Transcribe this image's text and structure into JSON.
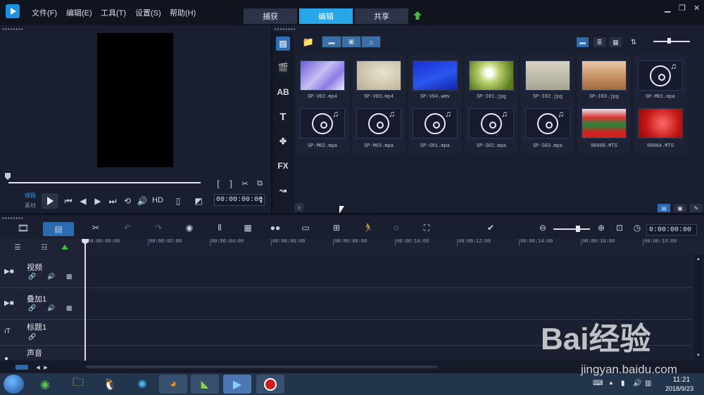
{
  "menus": [
    "文件(F)",
    "编辑(E)",
    "工具(T)",
    "设置(S)",
    "帮助(H)"
  ],
  "tabs": [
    {
      "label": "捕获",
      "active": false
    },
    {
      "label": "编辑",
      "active": true
    },
    {
      "label": "共享",
      "active": false
    }
  ],
  "colors": {
    "accent": "#27a6e8",
    "panel": "#1a1f30",
    "titlebar": "#10141f"
  },
  "preview": {
    "mode_project": "项目",
    "mode_clip": "素材",
    "hd_label": "HD",
    "timecode": "00:00:00:00"
  },
  "library": {
    "items": [
      {
        "name": "SP-V02.mp4",
        "kind": "video"
      },
      {
        "name": "SP-V03.mp4",
        "kind": "video"
      },
      {
        "name": "SP-V04.wmv",
        "kind": "video"
      },
      {
        "name": "SP-I01.jpg",
        "kind": "image"
      },
      {
        "name": "SP-I02.jpg",
        "kind": "image"
      },
      {
        "name": "SP-I03.jpg",
        "kind": "image"
      },
      {
        "name": "SP-M01.mpa",
        "kind": "audio"
      },
      {
        "name": "SP-M02.mpa",
        "kind": "audio"
      },
      {
        "name": "SP-M03.mpa",
        "kind": "audio"
      },
      {
        "name": "SP-S01.mpa",
        "kind": "audio"
      },
      {
        "name": "SP-S02.mpa",
        "kind": "audio"
      },
      {
        "name": "SP-S03.mpa",
        "kind": "audio"
      },
      {
        "name": "00060.MTS",
        "kind": "video"
      },
      {
        "name": "00064.MTS",
        "kind": "video"
      }
    ]
  },
  "timeline": {
    "timecode": "0:00:00:00",
    "ruler": [
      "00:00:00:00",
      "00:00:02:00",
      "00:00:04:00",
      "00:00:06:00",
      "00:00:08:00",
      "00:00:10:00",
      "00:00:12:00",
      "00:00:14:00",
      "00:00:16:00",
      "00:00:18:00"
    ],
    "tracks": [
      "视频",
      "叠加1",
      "标题1",
      "声音"
    ]
  },
  "taskbar": {
    "time": "11:21",
    "date": "2018/9/23"
  },
  "watermark": {
    "brand": "Bai经验",
    "url": "jingyan.baidu.com"
  }
}
